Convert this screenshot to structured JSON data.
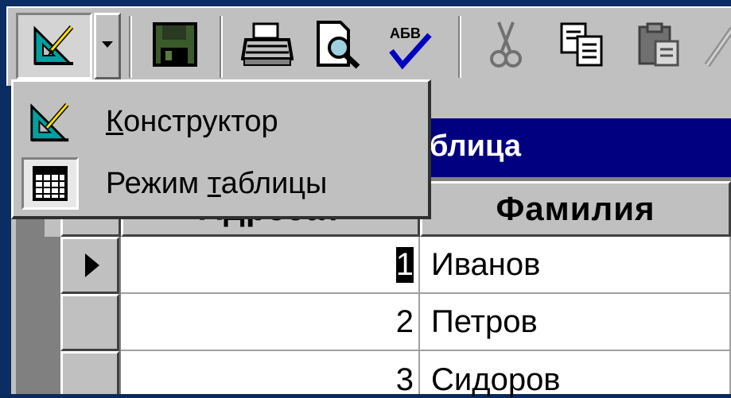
{
  "toolbar": {
    "buttons": [
      {
        "name": "design-view-icon"
      },
      {
        "name": "dropdown-arrow-icon"
      },
      {
        "name": "save-icon"
      },
      {
        "name": "print-icon"
      },
      {
        "name": "print-preview-icon"
      },
      {
        "name": "spelling-icon",
        "text": "АБВ"
      },
      {
        "name": "cut-icon"
      },
      {
        "name": "copy-icon"
      },
      {
        "name": "paste-icon"
      },
      {
        "name": "format-painter-icon"
      }
    ]
  },
  "view_menu": {
    "items": [
      {
        "accel": "К",
        "rest": "онструктор",
        "icon": "design-view-icon"
      },
      {
        "before": "Режим ",
        "accel": "т",
        "rest": "аблицы",
        "icon": "datasheet-view-icon"
      }
    ]
  },
  "window": {
    "title_visible": "блица"
  },
  "table": {
    "columns": [
      "Адресат",
      "Фамилия"
    ],
    "rows": [
      {
        "id": "1",
        "name": "Иванов",
        "current": true
      },
      {
        "id": "2",
        "name": "Петров",
        "current": false
      },
      {
        "id": "3",
        "name": "Сидоров",
        "current": false
      }
    ]
  },
  "colors": {
    "title_bar": "#000080",
    "face": "#c0c0c0",
    "frame": "#0b2d63"
  }
}
